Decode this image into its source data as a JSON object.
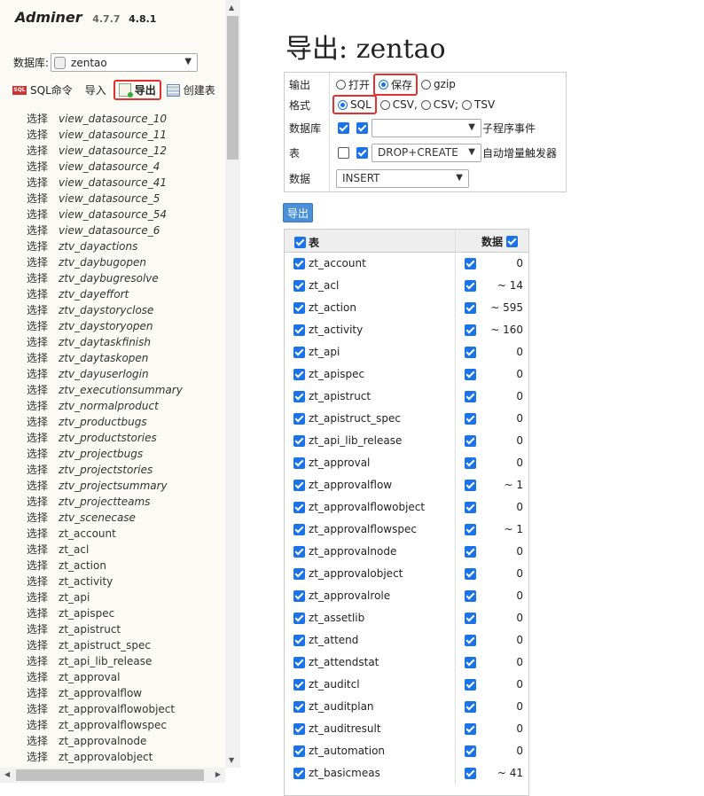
{
  "sidebar": {
    "logo": "Adminer",
    "version": "4.7.7",
    "version_new": "4.8.1",
    "db_label": "数据库:",
    "db_value": "zentao",
    "links": {
      "sql": "SQL命令",
      "import": "导入",
      "export": "导出",
      "create": "创建表"
    },
    "select_label": "选择",
    "tables": [
      {
        "name": "view_datasource_10",
        "view": true
      },
      {
        "name": "view_datasource_11",
        "view": true
      },
      {
        "name": "view_datasource_12",
        "view": true
      },
      {
        "name": "view_datasource_4",
        "view": true
      },
      {
        "name": "view_datasource_41",
        "view": true
      },
      {
        "name": "view_datasource_5",
        "view": true
      },
      {
        "name": "view_datasource_54",
        "view": true
      },
      {
        "name": "view_datasource_6",
        "view": true
      },
      {
        "name": "ztv_dayactions",
        "view": true
      },
      {
        "name": "ztv_daybugopen",
        "view": true
      },
      {
        "name": "ztv_daybugresolve",
        "view": true
      },
      {
        "name": "ztv_dayeffort",
        "view": true
      },
      {
        "name": "ztv_daystoryclose",
        "view": true
      },
      {
        "name": "ztv_daystoryopen",
        "view": true
      },
      {
        "name": "ztv_daytaskfinish",
        "view": true
      },
      {
        "name": "ztv_daytaskopen",
        "view": true
      },
      {
        "name": "ztv_dayuserlogin",
        "view": true
      },
      {
        "name": "ztv_executionsummary",
        "view": true
      },
      {
        "name": "ztv_normalproduct",
        "view": true
      },
      {
        "name": "ztv_productbugs",
        "view": true
      },
      {
        "name": "ztv_productstories",
        "view": true
      },
      {
        "name": "ztv_projectbugs",
        "view": true
      },
      {
        "name": "ztv_projectstories",
        "view": true
      },
      {
        "name": "ztv_projectsummary",
        "view": true
      },
      {
        "name": "ztv_projectteams",
        "view": true
      },
      {
        "name": "ztv_scenecase",
        "view": true
      },
      {
        "name": "zt_account",
        "view": false
      },
      {
        "name": "zt_acl",
        "view": false
      },
      {
        "name": "zt_action",
        "view": false
      },
      {
        "name": "zt_activity",
        "view": false
      },
      {
        "name": "zt_api",
        "view": false
      },
      {
        "name": "zt_apispec",
        "view": false
      },
      {
        "name": "zt_apistruct",
        "view": false
      },
      {
        "name": "zt_apistruct_spec",
        "view": false
      },
      {
        "name": "zt_api_lib_release",
        "view": false
      },
      {
        "name": "zt_approval",
        "view": false
      },
      {
        "name": "zt_approvalflow",
        "view": false
      },
      {
        "name": "zt_approvalflowobject",
        "view": false
      },
      {
        "name": "zt_approvalflowspec",
        "view": false
      },
      {
        "name": "zt_approvalnode",
        "view": false
      },
      {
        "name": "zt_approvalobject",
        "view": false
      }
    ]
  },
  "main": {
    "title": "导出: zentao",
    "output_label": "输出",
    "output_options": [
      "打开",
      "保存",
      "gzip"
    ],
    "format_label": "格式",
    "format_options": [
      "SQL",
      "CSV,",
      "CSV;",
      "TSV"
    ],
    "database_label": "数据库",
    "routines_label": "子程序",
    "events_label": "事件",
    "tables_label": "表",
    "table_style": "DROP+CREATE",
    "auto_increment_label": "自动增量",
    "triggers_label": "触发器",
    "data_label": "数据",
    "data_style": "INSERT",
    "export_button": "导出",
    "col_table": "表",
    "col_data": "数据",
    "rows": [
      {
        "name": "zt_account",
        "count": "0"
      },
      {
        "name": "zt_acl",
        "count": "~ 14"
      },
      {
        "name": "zt_action",
        "count": "~ 595"
      },
      {
        "name": "zt_activity",
        "count": "~ 160"
      },
      {
        "name": "zt_api",
        "count": "0"
      },
      {
        "name": "zt_apispec",
        "count": "0"
      },
      {
        "name": "zt_apistruct",
        "count": "0"
      },
      {
        "name": "zt_apistruct_spec",
        "count": "0"
      },
      {
        "name": "zt_api_lib_release",
        "count": "0"
      },
      {
        "name": "zt_approval",
        "count": "0"
      },
      {
        "name": "zt_approvalflow",
        "count": "~ 1"
      },
      {
        "name": "zt_approvalflowobject",
        "count": "0"
      },
      {
        "name": "zt_approvalflowspec",
        "count": "~ 1"
      },
      {
        "name": "zt_approvalnode",
        "count": "0"
      },
      {
        "name": "zt_approvalobject",
        "count": "0"
      },
      {
        "name": "zt_approvalrole",
        "count": "0"
      },
      {
        "name": "zt_assetlib",
        "count": "0"
      },
      {
        "name": "zt_attend",
        "count": "0"
      },
      {
        "name": "zt_attendstat",
        "count": "0"
      },
      {
        "name": "zt_auditcl",
        "count": "0"
      },
      {
        "name": "zt_auditplan",
        "count": "0"
      },
      {
        "name": "zt_auditresult",
        "count": "0"
      },
      {
        "name": "zt_automation",
        "count": "0"
      },
      {
        "name": "zt_basicmeas",
        "count": "~ 41"
      }
    ]
  }
}
